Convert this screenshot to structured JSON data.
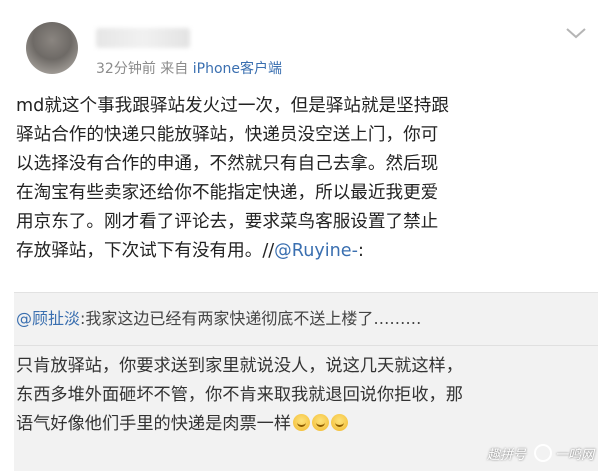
{
  "post": {
    "time": "32分钟前",
    "source_prefix": "来自",
    "source": "iPhone客户端",
    "lines": [
      "md就这个事我跟驿站发火过一次，但是驿站就是坚持跟",
      "驿站合作的快递只能放驿站，快递员没空送上门，你可",
      "以选择没有合作的申通，不然就只有自己去拿。然后现",
      "在淘宝有些卖家还给你不能指定快递，所以最近我更爱",
      "用京东了。刚才看了评论去，要求菜鸟客服设置了禁止",
      "存放驿站，下次试下有没有用。//"
    ],
    "repost_mention": "@Ruyine-",
    "repost_colon": ":"
  },
  "quoted": {
    "mention": "@顾扯淡",
    "text": ":我家这边已经有两家快递彻底不送上楼了………",
    "lines": [
      "只肯放驿站，你要求送到家里就说没人，说这几天就这样，",
      "东西多堆外面砸坏不管，你不肯来取我就退回说你拒收，那",
      "语气好像他们手里的快递是肉票一样"
    ],
    "emoji_count": 3,
    "emoji_icon": "grin-emoji-icon"
  },
  "watermark": {
    "left": "趣拼号",
    "right": "一鸣网"
  },
  "colors": {
    "link": "#3a6fb0",
    "meta": "#8c8c8c",
    "quote_bg": "#f2f2f2"
  }
}
